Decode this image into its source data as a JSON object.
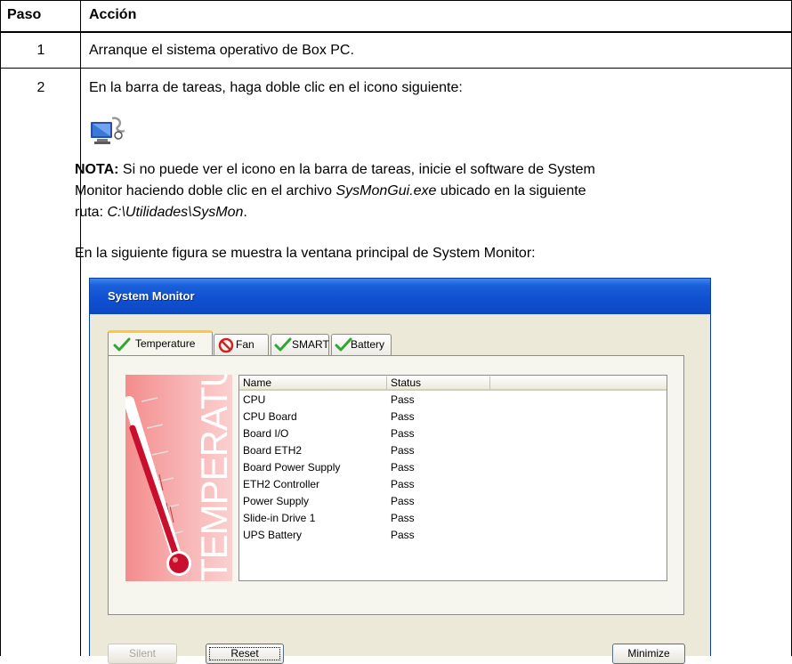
{
  "table": {
    "headers": {
      "step": "Paso",
      "action": "Acción"
    },
    "rows": [
      {
        "step": "1",
        "action": "Arranque el sistema operativo de Box PC."
      },
      {
        "step": "2",
        "action": "En la barra de tareas, haga doble clic en el icono siguiente:"
      }
    ]
  },
  "note": {
    "label": "NOTA:",
    "text1": " Si no puede ver el icono en la barra de tareas, inicie el software de System",
    "text2a": "Monitor haciendo doble clic en el archivo ",
    "file": "SysMonGui.exe",
    "text2b": " ubicado en la siguiente",
    "text3a": "ruta: ",
    "path": "C:\\Utilidades\\SysMon",
    "text3b": "."
  },
  "figure_caption": "En la siguiente figura se muestra la ventana principal de System Monitor:",
  "window": {
    "title": "System Monitor",
    "tabs": [
      {
        "label": "Temperature",
        "icon": "check-icon",
        "active": true
      },
      {
        "label": "Fan",
        "icon": "no-entry-icon",
        "active": false
      },
      {
        "label": "SMART",
        "icon": "check-icon",
        "active": false
      },
      {
        "label": "Battery",
        "icon": "check-icon",
        "active": false
      }
    ],
    "thermometer_label": "TEMPERATURE",
    "list": {
      "columns": [
        "Name",
        "Status"
      ],
      "rows": [
        {
          "name": "CPU",
          "status": "Pass"
        },
        {
          "name": "CPU Board",
          "status": "Pass"
        },
        {
          "name": "Board I/O",
          "status": "Pass"
        },
        {
          "name": "Board ETH2",
          "status": "Pass"
        },
        {
          "name": "Board Power Supply",
          "status": "Pass"
        },
        {
          "name": "ETH2 Controller",
          "status": "Pass"
        },
        {
          "name": "Power Supply",
          "status": "Pass"
        },
        {
          "name": "Slide-in Drive 1",
          "status": "Pass"
        },
        {
          "name": "UPS Battery",
          "status": "Pass"
        }
      ]
    },
    "buttons": {
      "silent": "Silent",
      "reset": "Reset",
      "minimize": "Minimize"
    },
    "colors": {
      "title_bar": "#0f4fd0",
      "tab_highlight": "#ffc73c",
      "check": "#2da835",
      "no_entry": "#d21f1f",
      "thermo_red": "#c8102e"
    }
  }
}
